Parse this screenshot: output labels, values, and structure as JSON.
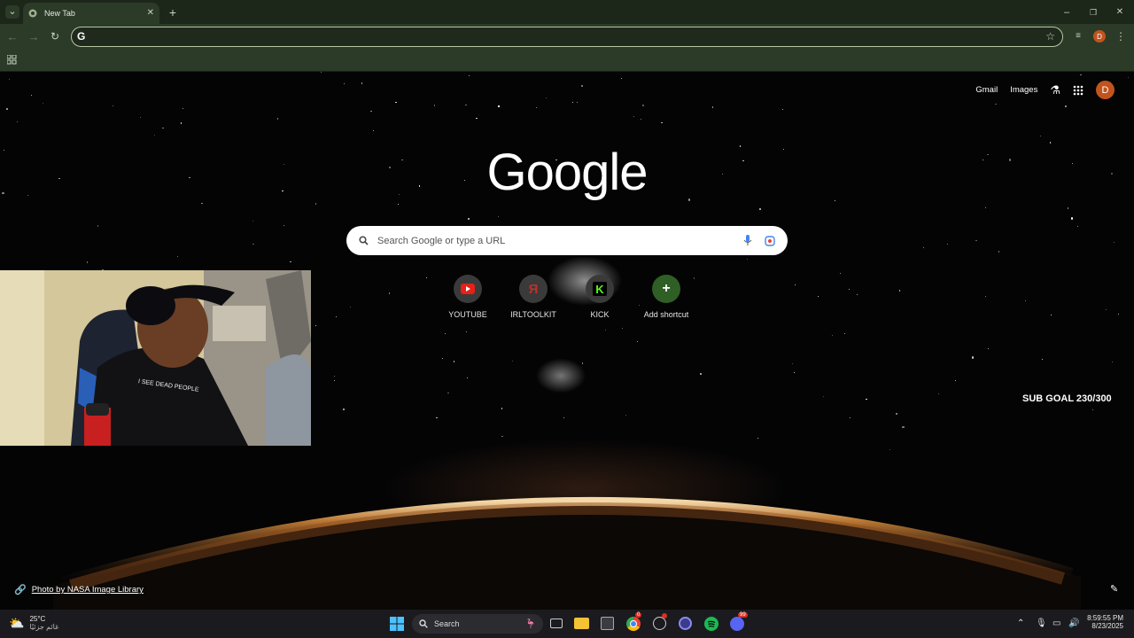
{
  "browser": {
    "tab_title": "New Tab",
    "omnibox_value": "",
    "colors": {
      "frame": "#1c2619",
      "toolbar": "#2c3a28",
      "omnibox_border": "#b6c7a6"
    },
    "profile_initial": "D"
  },
  "ntp": {
    "logo_text": "Google",
    "search_placeholder": "Search Google or type a URL",
    "top_links": {
      "gmail": "Gmail",
      "images": "Images"
    },
    "profile_initial": "D",
    "shortcuts": [
      {
        "label": "YOUTUBE",
        "icon": "youtube-icon",
        "color": "#e62117"
      },
      {
        "label": "IRLTOOLKIT",
        "icon": "irltoolkit-icon",
        "color": "#b8332b"
      },
      {
        "label": "KICK",
        "icon": "kick-icon",
        "color": "#53fc18"
      },
      {
        "label": "Add shortcut",
        "icon": "plus-icon",
        "color": "#3e8e2f"
      }
    ],
    "background_credit": "Photo by NASA Image Library",
    "overlay_text": "SUB GOAL 230/300"
  },
  "webcam": {
    "shirt_text": "I SEE DEAD PEOPLE"
  },
  "taskbar": {
    "weather_temp": "25°C",
    "weather_desc": "غائم جزئيًا",
    "search_label": "Search",
    "time": "8:59:55 PM",
    "date": "8/23/2025",
    "badges": {
      "chrome": "0",
      "discord": "99"
    }
  }
}
